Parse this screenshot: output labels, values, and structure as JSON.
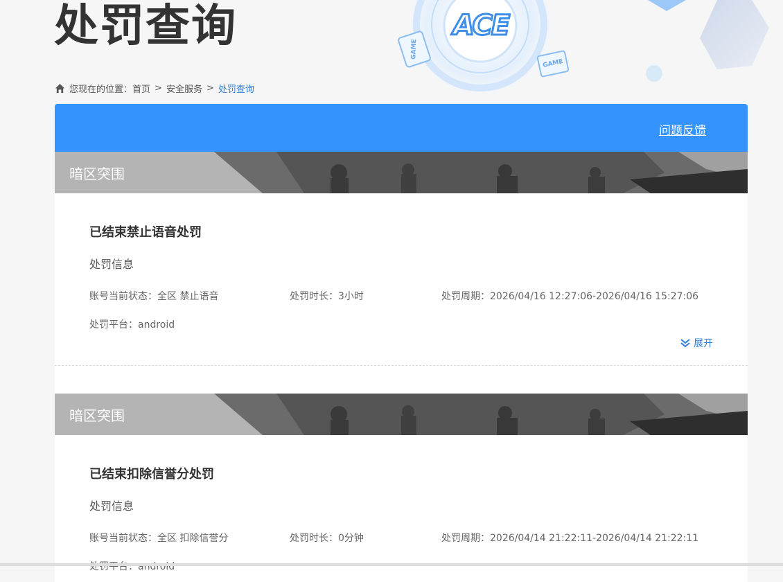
{
  "page": {
    "title": "处罚查询"
  },
  "breadcrumb": {
    "prefix": "您现在的位置：",
    "items": [
      "首页",
      "安全服务"
    ],
    "separator": ">",
    "current": "处罚查询"
  },
  "header": {
    "feedback_label": "问题反馈",
    "accent_color": "#3593fe"
  },
  "logo": {
    "text": "ACE",
    "badges": [
      "GAME",
      "GAME"
    ]
  },
  "records": [
    {
      "game": "暗区突围",
      "title": "已结束禁止语音处罚",
      "section": "处罚信息",
      "status_label": "账号当前状态：",
      "status_value": "全区 禁止语音",
      "duration_label": "处罚时长：",
      "duration_value": "3小时",
      "period_label": "处罚周期：",
      "period_value": "2026/04/16 12:27:06-2026/04/16 15:27:06",
      "platform_label": "处罚平台：",
      "platform_value": "android",
      "expand_label": "展开"
    },
    {
      "game": "暗区突围",
      "title": "已结束扣除信誉分处罚",
      "section": "处罚信息",
      "status_label": "账号当前状态：",
      "status_value": "全区 扣除信誉分",
      "duration_label": "处罚时长：",
      "duration_value": "0分钟",
      "period_label": "处罚周期：",
      "period_value": "2026/04/14 21:22:11-2026/04/14 21:22:11",
      "platform_label": "处罚平台：",
      "platform_value": "android"
    }
  ]
}
